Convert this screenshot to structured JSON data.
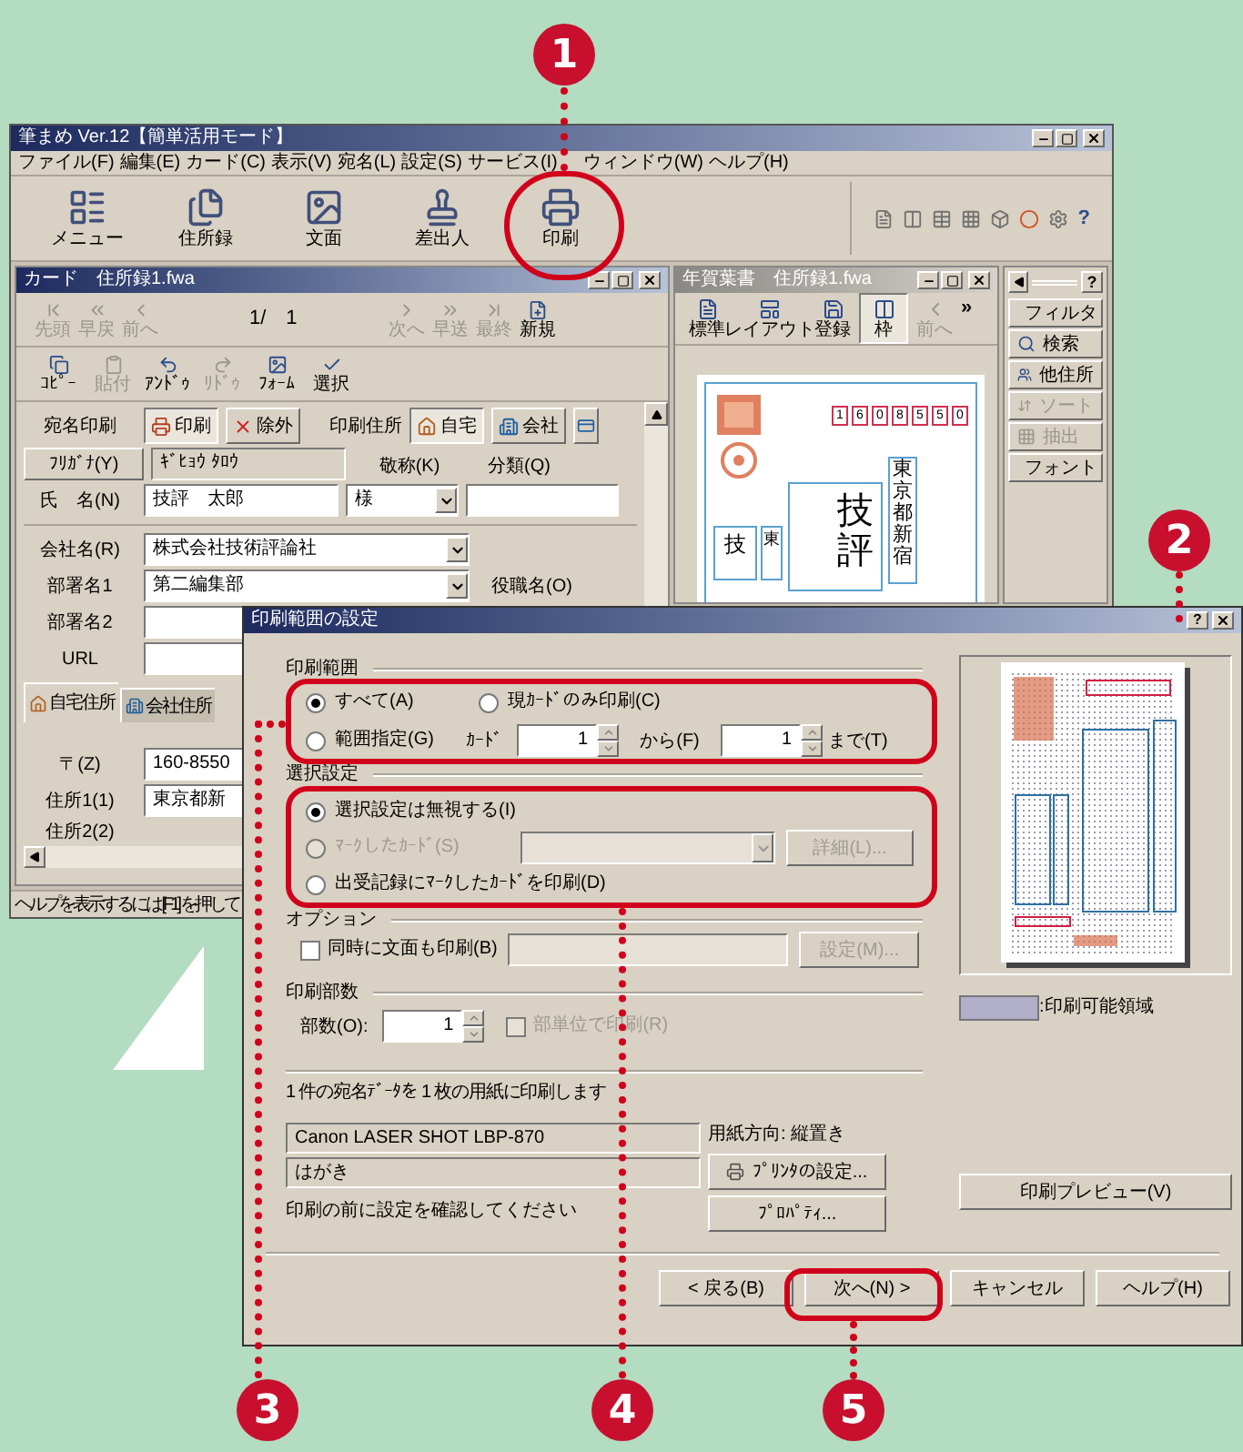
{
  "app_window": {
    "title": "筆まめ Ver.12【簡単活用モード】",
    "menu": [
      "ファイル(F)",
      "編集(E)",
      "カード(C)",
      "表示(V)",
      "宛名(L)",
      "設定(S)",
      "サービス(I)",
      "ウィンドウ(W)",
      "ヘルプ(H)"
    ],
    "toolbar": [
      {
        "label": "メニュー"
      },
      {
        "label": "住所録"
      },
      {
        "label": "文面"
      },
      {
        "label": "差出人"
      },
      {
        "label": "印刷"
      }
    ],
    "help_mark": "?"
  },
  "card_window": {
    "title": "カード　住所録1.fwa",
    "nav_back": [
      {
        "label": "先頭",
        "disabled": true
      },
      {
        "label": "早戻",
        "disabled": true
      },
      {
        "label": "前へ",
        "disabled": true
      }
    ],
    "record": "1/　1",
    "nav_next": [
      {
        "label": "次へ",
        "disabled": true
      },
      {
        "label": "早送",
        "disabled": true
      },
      {
        "label": "最終",
        "disabled": true
      },
      {
        "label": "新規",
        "disabled": false
      }
    ],
    "edit_tools": [
      {
        "label": "ｺﾋﾟｰ",
        "disabled": false
      },
      {
        "label": "貼付",
        "disabled": true
      },
      {
        "label": "ｱﾝﾄﾞｩ",
        "disabled": false
      },
      {
        "label": "ﾘﾄﾞｩ",
        "disabled": true
      },
      {
        "label": "ﾌｫｰﾑ",
        "disabled": false
      },
      {
        "label": "選択",
        "disabled": false
      }
    ],
    "print_label": "宛名印刷",
    "print_toggle": [
      {
        "label": "印刷",
        "selected": true
      },
      {
        "label": "除外",
        "selected": false
      }
    ],
    "address_label": "印刷住所",
    "address_toggle": [
      {
        "label": "自宅",
        "selected": true
      },
      {
        "label": "会社",
        "selected": false
      }
    ],
    "furigana_button": "ﾌﾘｶﾞﾅ(Y)",
    "furigana": "ｷﾞﾋｮｳ ﾀﾛｳ",
    "honorific_label": "敬称(K)",
    "category_label": "分類(Q)",
    "name_label": "氏　名(N)",
    "name": "技評　太郎",
    "honorific": "様",
    "company_label": "会社名(R)",
    "company": "株式会社技術評論社",
    "dept1_label": "部署名1",
    "dept1": "第二編集部",
    "position_label": "役職名(O)",
    "dept2_label": "部署名2",
    "url_label": "URL",
    "tabs": [
      {
        "label": "自宅住所",
        "selected": true
      },
      {
        "label": "会社住所",
        "selected": false
      }
    ],
    "zip_label": "〒(Z)",
    "zip": "160-8550",
    "address1_label": "住所1(1)",
    "address1": "東京都新",
    "address2_label": "住所2(2)"
  },
  "status_bar": "ヘルプを表示するには [F1] を押して",
  "preview_window": {
    "title": "年賀葉書　住所録1.fwa",
    "tools": [
      {
        "label": "標準",
        "selected": false,
        "disabled": false
      },
      {
        "label": "レイアウト",
        "selected": false,
        "disabled": false
      },
      {
        "label": "登録",
        "selected": false,
        "disabled": false
      },
      {
        "label": "枠",
        "selected": true,
        "disabled": false
      },
      {
        "label": "前へ",
        "selected": false,
        "disabled": true
      }
    ],
    "more": "»",
    "postal_code": [
      "1",
      "6",
      "0",
      "8",
      "5",
      "5",
      "0"
    ],
    "recipient": "技評",
    "address": "東京都新宿",
    "sender_name": "技",
    "sender_address": "東"
  },
  "side_panel": {
    "help": "?",
    "tools": [
      {
        "label": "フィルタ",
        "disabled": false
      },
      {
        "label": "検索",
        "disabled": false
      },
      {
        "label": "他住所",
        "disabled": false
      },
      {
        "label": "ソート",
        "disabled": true
      },
      {
        "label": "抽出",
        "disabled": true
      },
      {
        "label": "フォント",
        "disabled": false
      }
    ]
  },
  "dialog": {
    "title": "印刷範囲の設定",
    "help": "?",
    "range": {
      "heading": "印刷範囲",
      "options": [
        {
          "label": "すべて(A)",
          "selected": true
        },
        {
          "label": "現ｶｰﾄﾞのみ印刷(C)",
          "selected": false
        },
        {
          "label": "範囲指定(G)",
          "selected": false
        }
      ],
      "card_label": "ｶｰﾄﾞ",
      "from": "1",
      "from_label": "から(F)",
      "to": "1",
      "to_label": "まで(T)"
    },
    "selection": {
      "heading": "選択設定",
      "options": [
        {
          "label": "選択設定は無視する(I)",
          "selected": true,
          "disabled": false
        },
        {
          "label": "ﾏｰｸしたｶｰﾄﾞ(S)",
          "selected": false,
          "disabled": true
        },
        {
          "label": "出受記録にﾏｰｸしたｶｰﾄﾞを印刷(D)",
          "selected": false,
          "disabled": false
        }
      ],
      "detail_button": {
        "label": "詳細(L)...",
        "disabled": true
      }
    },
    "option": {
      "heading": "オプション",
      "print_design": {
        "label": "同時に文面も印刷(B)",
        "checked": false
      },
      "settings_button": {
        "label": "設定(M)...",
        "disabled": true
      }
    },
    "copies": {
      "heading": "印刷部数",
      "label": "部数(O):",
      "value": "1",
      "collate": {
        "label": "部単位で印刷(R)",
        "checked": false,
        "disabled": true
      }
    },
    "summary": "1 件の宛名ﾃﾞｰﾀを 1 枚の用紙に印刷します",
    "printer": "Canon LASER SHOT LBP-870",
    "paper": "はがき",
    "orientation": "用紙方向: 縦置き",
    "printer_settings_button": "ﾌﾟﾘﾝﾀの設定...",
    "confirm_note": "印刷の前に設定を確認してください",
    "properties_button": "ﾌﾟﾛﾊﾟﾃｨ...",
    "legend": ":印刷可能領域",
    "preview_button": "印刷プレビュー(V)",
    "buttons": [
      {
        "label": "< 戻る(B)"
      },
      {
        "label": "次へ(N) >"
      },
      {
        "label": "キャンセル"
      },
      {
        "label": "ヘルプ(H)"
      }
    ]
  },
  "callouts": [
    "1",
    "2",
    "3",
    "4",
    "5"
  ]
}
